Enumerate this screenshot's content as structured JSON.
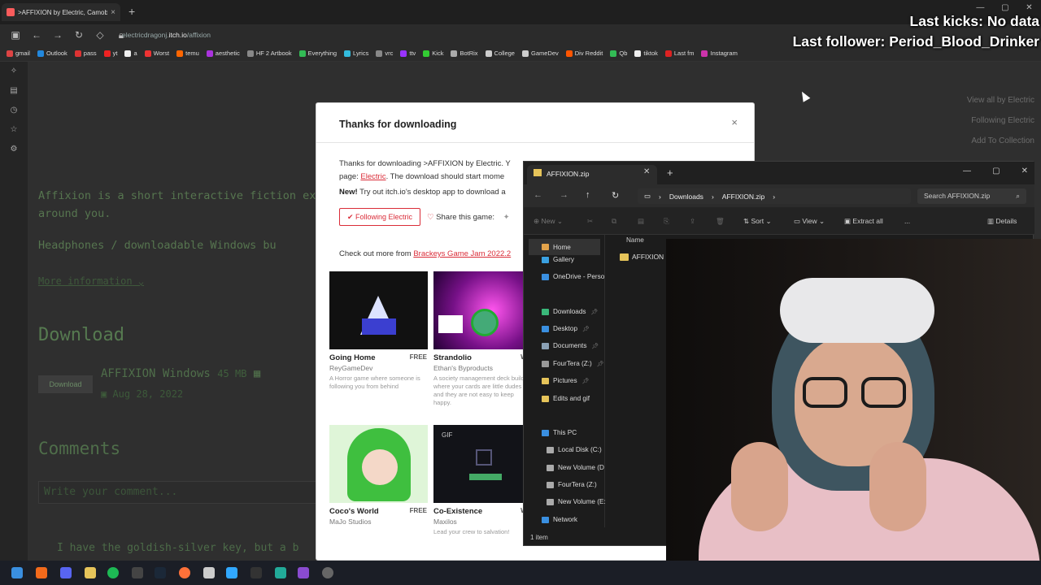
{
  "browser": {
    "tab_title": ">AFFIXION by Electric, Camobi",
    "tab_close": "×",
    "new_tab": "+",
    "url_host": "electricdragonj.",
    "url_domain": "itch.io",
    "url_path": "/affixion",
    "bookmarks": [
      {
        "label": "gmail",
        "color": "#d44"
      },
      {
        "label": "Outlook",
        "color": "#28d"
      },
      {
        "label": "pass",
        "color": "#d33"
      },
      {
        "label": "yt",
        "color": "#e22"
      },
      {
        "label": "a",
        "color": "#eee"
      },
      {
        "label": "Worst",
        "color": "#e33"
      },
      {
        "label": "temu",
        "color": "#f60"
      },
      {
        "label": "aesthetic",
        "color": "#a3d"
      },
      {
        "label": "HF 2 Artbook",
        "color": "#888"
      },
      {
        "label": "Everything",
        "color": "#3b5"
      },
      {
        "label": "Lyrics",
        "color": "#3bd"
      },
      {
        "label": "vrc",
        "color": "#888"
      },
      {
        "label": "ttv",
        "color": "#93f"
      },
      {
        "label": "Kick",
        "color": "#3c3"
      },
      {
        "label": "BotRix",
        "color": "#aaa"
      },
      {
        "label": "College",
        "color": "#ccc"
      },
      {
        "label": "GameDev",
        "color": "#ccc"
      },
      {
        "label": "Div Reddit",
        "color": "#f50"
      },
      {
        "label": "Qb",
        "color": "#3b5"
      },
      {
        "label": "tiktok",
        "color": "#eee"
      },
      {
        "label": "Last fm",
        "color": "#d22"
      },
      {
        "label": "Instagram",
        "color": "#c3a"
      }
    ]
  },
  "itch_page": {
    "description": "Affixion is a short interactive fiction exp around you.",
    "note": "Headphones / downloadable Windows bu",
    "more_info": "More information",
    "download_heading": "Download",
    "download_button": "Download",
    "file_name": "AFFIXION Windows",
    "file_size": "45 MB",
    "file_date": "Aug 28, 2022",
    "comments_heading": "Comments",
    "comment_placeholder": "Write your comment...",
    "comment_text": "I have the goldish-silver key, but a b",
    "side_links": [
      "View all by Electric",
      "Following Electric",
      "Add To Collection"
    ]
  },
  "modal": {
    "title": "Thanks for downloading",
    "close": "×",
    "body_start": "Thanks for downloading >AFFIXION by Electric. Y",
    "body_page": "page:",
    "body_link": "Electric",
    "body_end": ". The download should start mome",
    "new_label": "New!",
    "new_text": "Try out itch.io's desktop app to download a",
    "follow_button": "Following Electric",
    "share_label": "Share this game:",
    "checkout_text": "Check out more from",
    "checkout_link": "Brackeys Game Jam 2022.2",
    "games": [
      {
        "name": "Going Home",
        "price": "FREE",
        "author": "ReyGameDev",
        "desc": "A Horror game where someone is following you from behind"
      },
      {
        "name": "Strandolio",
        "price": "WE",
        "author": "Ethan's Byproducts",
        "desc": "A society management deck builder where your cards are little dudes and they are not easy to keep happy."
      },
      {
        "name": "Coco's World",
        "price": "FREE",
        "author": "MaJo Studios",
        "desc": ""
      },
      {
        "name": "Co-Existence",
        "price": "WE",
        "author": "Maxilos",
        "desc": "Lead your crew to salvation!"
      }
    ],
    "gif_badge": "GIF"
  },
  "explorer": {
    "tab_title": "AFFIXION.zip",
    "crumbs": [
      "Downloads",
      "AFFIXION.zip"
    ],
    "search_placeholder": "Search AFFIXION.zip",
    "toolbar": {
      "new": "New",
      "sort": "Sort",
      "view": "View",
      "extract": "Extract all",
      "more": "...",
      "details": "Details"
    },
    "nav": [
      {
        "label": "Home",
        "color": "#e3a34b",
        "pin": false
      },
      {
        "label": "Gallery",
        "color": "#3aa0e0",
        "pin": false
      },
      {
        "label": "OneDrive - Perso",
        "color": "#3a8fe0",
        "pin": false
      },
      {
        "label": "Downloads",
        "color": "#3ab87a",
        "pin": true
      },
      {
        "label": "Desktop",
        "color": "#3a8fe0",
        "pin": true
      },
      {
        "label": "Documents",
        "color": "#8aa0b5",
        "pin": true
      },
      {
        "label": "FourTera (Z:)",
        "color": "#999",
        "pin": true
      },
      {
        "label": "Pictures",
        "color": "#e6c45a",
        "pin": true
      },
      {
        "label": "Edits and gif",
        "color": "#e6c45a",
        "pin": false
      }
    ],
    "nav2": [
      {
        "label": "This PC",
        "color": "#3a8fe0"
      },
      {
        "label": "Local Disk (C:)",
        "color": "#aaa"
      },
      {
        "label": "New Volume (D",
        "color": "#aaa"
      },
      {
        "label": "FourTera (Z:)",
        "color": "#aaa"
      },
      {
        "label": "New Volume (E:",
        "color": "#aaa"
      },
      {
        "label": "Network",
        "color": "#3a8fe0"
      }
    ],
    "column_name": "Name",
    "file": "AFFIXION",
    "status": "1 item"
  },
  "overlay": {
    "line1": "Last kicks: No data",
    "line2": "Last follower: Period_Blood_Drinker"
  }
}
